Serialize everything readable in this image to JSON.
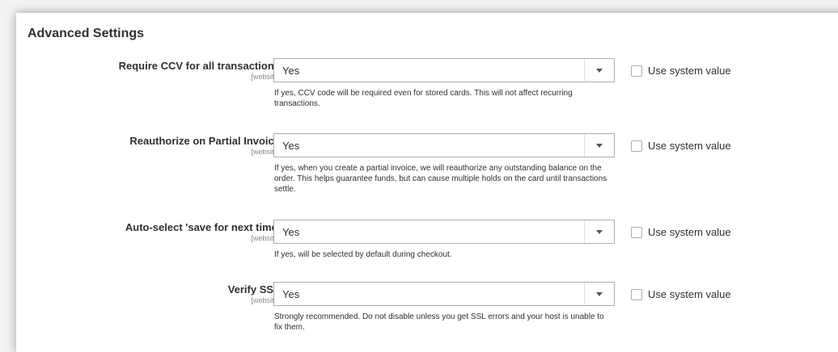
{
  "section": {
    "title": "Advanced Settings"
  },
  "fields": [
    {
      "label": "Require CCV for all transactions",
      "scope": "[website]",
      "value": "Yes",
      "note": "If yes, CCV code will be required even for stored cards. This will not affect recurring transactions.",
      "use_system_label": "Use system value",
      "use_system_checked": false
    },
    {
      "label": "Reauthorize on Partial Invoice",
      "scope": "[website]",
      "value": "Yes",
      "note": "If yes, when you create a partial invoice, we will reauthorize any outstanding balance on the order. This helps guarantee funds, but can cause multiple holds on the card until transactions settle.",
      "use_system_label": "Use system value",
      "use_system_checked": false
    },
    {
      "label": "Auto-select 'save for next time'",
      "scope": "[website]",
      "value": "Yes",
      "note": "If yes, will be selected by default during checkout.",
      "use_system_label": "Use system value",
      "use_system_checked": false
    },
    {
      "label": "Verify SSL",
      "scope": "[website]",
      "value": "Yes",
      "note": "Strongly recommended. Do not disable unless you get SSL errors and your host is unable to fix them.",
      "use_system_label": "Use system value",
      "use_system_checked": false
    }
  ],
  "icons": {
    "dropdown": "chevron-down-icon"
  }
}
